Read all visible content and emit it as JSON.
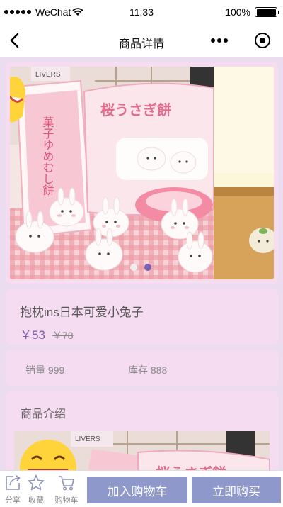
{
  "status_bar": {
    "carrier": "WeChat",
    "time": "11:33",
    "battery": "100%",
    "battery_level": 1.0
  },
  "nav": {
    "title": "商品详情"
  },
  "banner": {
    "slide_count": 2,
    "active_index": 1,
    "slide1_sign_text": "菓子ゆめむし餅",
    "slide1_bag_text": "桜うさぎ餅",
    "slide1_card_text": "LIVERS"
  },
  "product": {
    "name": "抱枕ins日本可爱小兔子",
    "price": "￥53",
    "original_price": "￥78"
  },
  "stats": {
    "sales": "销量 999",
    "stock": "库存 888"
  },
  "intro": {
    "title": "商品介绍",
    "image_card_text": "LIVERS",
    "image_bag_text": "桜うさぎ餅"
  },
  "tabbar": {
    "share": "分享",
    "favorite": "收藏",
    "cart": "购物车",
    "add_to_cart": "加入购物车",
    "buy_now": "立即购买"
  },
  "colors": {
    "page_bg": "#ecdcef",
    "card_bg": "#f6dcf0",
    "price": "#7b5aa6",
    "button": "#8f98cb",
    "indicator_active": "#7a63b3"
  }
}
